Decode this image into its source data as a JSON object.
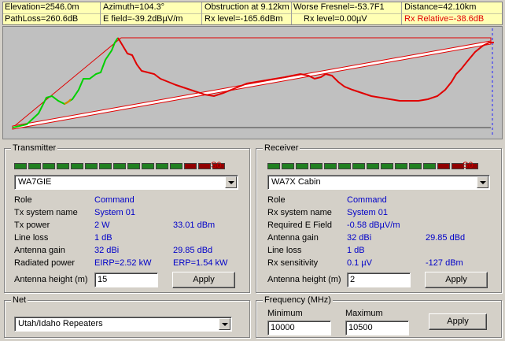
{
  "info": {
    "elevation": "Elevation=2546.0m",
    "azimuth": "Azimuth=104.3°",
    "obstruction": "Obstruction at 9.12km",
    "worse_fresnel": "Worse Fresnel=-53.7F1",
    "distance": "Distance=42.10km",
    "pathloss": "PathLoss=260.6dB",
    "efield": "E field=-39.2dBµV/m",
    "rx_level_dbm": "Rx level=-165.6dBm",
    "rx_level_uv": "Rx level=0.00µV",
    "rx_relative": "Rx Relative=-38.6dB",
    "rx_relative_color": "#e00000"
  },
  "transmitter": {
    "title": "Transmitter",
    "meter_label": "S0",
    "station": "WA7GIE",
    "rows": [
      {
        "label": "Role",
        "value": "Command",
        "value2": ""
      },
      {
        "label": "Tx system name",
        "value": "System 01",
        "value2": ""
      },
      {
        "label": "Tx power",
        "value": "2 W",
        "value2": "33.01 dBm"
      },
      {
        "label": "Line loss",
        "value": "1 dB",
        "value2": ""
      },
      {
        "label": "Antenna gain",
        "value": "32 dBi",
        "value2": "29.85 dBd"
      },
      {
        "label": "Radiated power",
        "value": "EIRP=2.52 kW",
        "value2": "ERP=1.54 kW"
      }
    ],
    "antenna_label": "Antenna height (m)",
    "antenna_value": "15",
    "apply": "Apply"
  },
  "receiver": {
    "title": "Receiver",
    "meter_label": "S0",
    "station": "WA7X Cabin",
    "rows": [
      {
        "label": "Role",
        "value": "Command",
        "value2": ""
      },
      {
        "label": "Rx system name",
        "value": "System 01",
        "value2": ""
      },
      {
        "label": "Required E Field",
        "value": "-0.58 dBµV/m",
        "value2": ""
      },
      {
        "label": "Antenna gain",
        "value": "32 dBi",
        "value2": "29.85 dBd"
      },
      {
        "label": "Line loss",
        "value": "1 dB",
        "value2": ""
      },
      {
        "label": "Rx sensitivity",
        "value": "0.1 µV",
        "value2": "-127 dBm"
      }
    ],
    "antenna_label": "Antenna height (m)",
    "antenna_value": "2",
    "apply": "Apply"
  },
  "net": {
    "title": "Net",
    "value": "Utah/Idaho Repeaters"
  },
  "frequency": {
    "title": "Frequency (MHz)",
    "min_label": "Minimum",
    "max_label": "Maximum",
    "min_value": "10000",
    "max_value": "10500",
    "apply": "Apply"
  },
  "colors": {
    "terrain_clear": "#00d000",
    "terrain_obstructed": "#e00000",
    "line_of_sight": "#e00000",
    "meter_green": "#208020",
    "meter_red": "#900000"
  }
}
